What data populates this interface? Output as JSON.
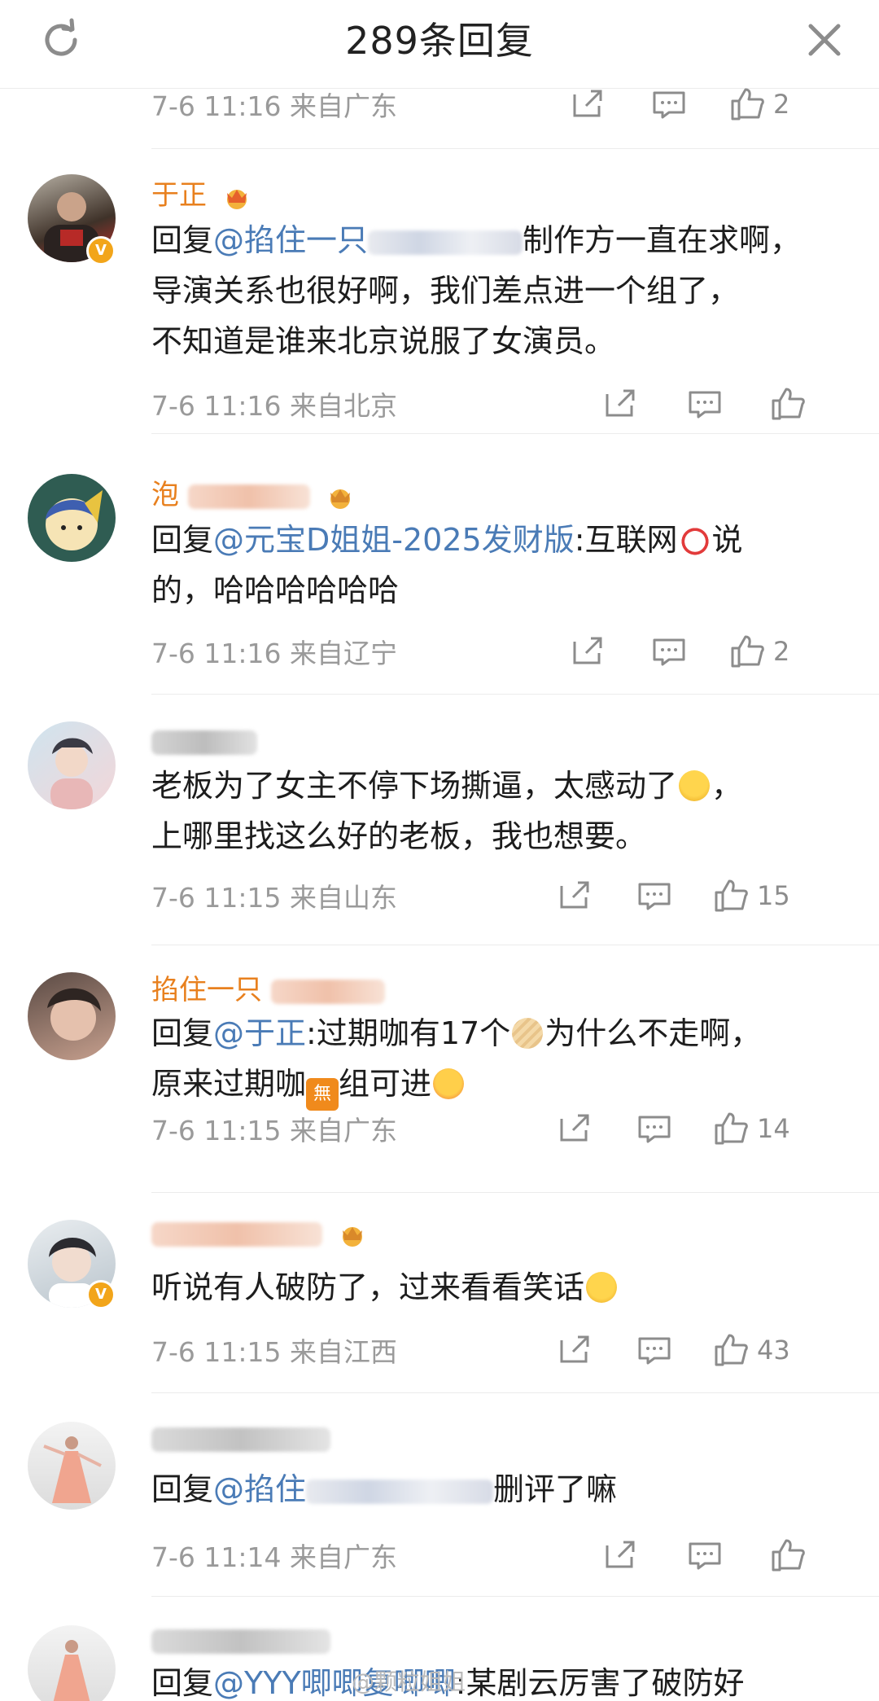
{
  "header": {
    "title": "289条回复",
    "refresh_icon": "refresh-icon",
    "close_icon": "close-icon"
  },
  "colors": {
    "username": "#e8801e",
    "mention": "#4a7bb6",
    "meta": "#9a9a9a",
    "badge": "#f2a51a"
  },
  "top_meta": {
    "time_location": "7-6 11:16 来自广东",
    "like_count": "2"
  },
  "comments": [
    {
      "username": "于正",
      "body_prefix": "回复",
      "mention": "@掐住一只",
      "body_lines": [
        "制作方一直在求啊，",
        "导演关系也很好啊，我们差点进一个组了，",
        "不知道是谁来北京说服了女演员。"
      ],
      "meta": "7-6 11:16 来自北京",
      "like_count": ""
    },
    {
      "username": "泡",
      "body_prefix": "回复",
      "mention": "@元宝D姐姐-2025发财版",
      "body_line1_rest": ":互联网",
      "body_line1_end": "说",
      "body_line2": "的，哈哈哈哈哈哈",
      "emoji": "clown-emoji",
      "meta": "7-6 11:16 来自辽宁",
      "like_count": "2"
    },
    {
      "username": "",
      "body_line1": "老板为了女主不停下场撕逼，太感动了",
      "body_line1_end": "，",
      "body_line2": "上哪里找这么好的老板，我也想要。",
      "emoji": "crying-emoji",
      "meta": "7-6 11:15 来自山东",
      "like_count": "15"
    },
    {
      "username": "掐住一只",
      "body_prefix": "回复",
      "mention": "@于正",
      "body_line1_rest": ":过期咖有17个",
      "body_line1_end": "为什么不走啊，",
      "body_line2_a": "原来过期咖",
      "body_line2_mark": "無",
      "body_line2_b": "组可进",
      "meta": "7-6 11:15 来自广东",
      "like_count": "14"
    },
    {
      "username": "",
      "body_line1": "听说有人破防了，过来看看笑话",
      "meta": "7-6 11:15 来自江西",
      "like_count": "43"
    },
    {
      "username": "",
      "body_prefix": "回复",
      "mention": "@掐住",
      "body_line1_end": "删评了嘛",
      "meta": "7-6 11:14 来自广东",
      "like_count": ""
    },
    {
      "username": "",
      "body_prefix": "回复",
      "mention": "@YYY唧唧复唧唧",
      "body_line1_end": ":某剧云厉害了破防好"
    }
  ],
  "watermark": "@颗粒姐姐"
}
